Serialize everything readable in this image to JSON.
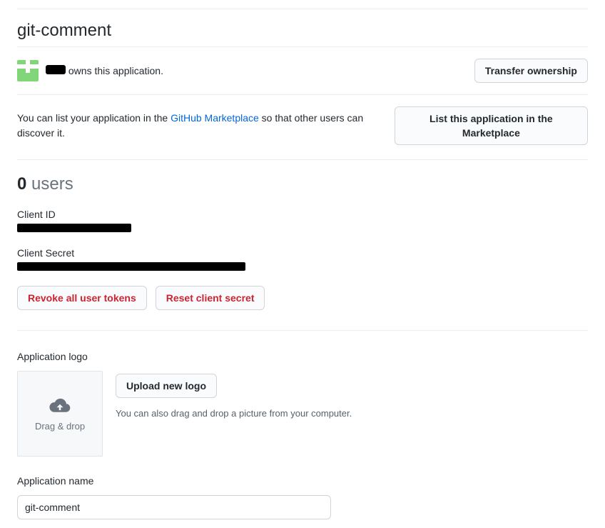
{
  "title": "git-comment",
  "owner": {
    "name": "",
    "owns_text": " owns this application."
  },
  "buttons": {
    "transfer_ownership": "Transfer ownership",
    "list_marketplace": "List this application in the Marketplace",
    "revoke_tokens": "Revoke all user tokens",
    "reset_secret": "Reset client secret",
    "upload_logo": "Upload new logo"
  },
  "marketplace": {
    "prefix": "You can list your application in the ",
    "link_text": "GitHub Marketplace",
    "suffix": " so that other users can discover it."
  },
  "users": {
    "count": "0",
    "label": " users"
  },
  "credentials": {
    "client_id_label": "Client ID",
    "client_secret_label": "Client Secret"
  },
  "logo": {
    "section_label": "Application logo",
    "drop_label": "Drag & drop",
    "hint": "You can also drag and drop a picture from your computer."
  },
  "fields": {
    "app_name_label": "Application name",
    "app_name_value": "git-comment"
  }
}
